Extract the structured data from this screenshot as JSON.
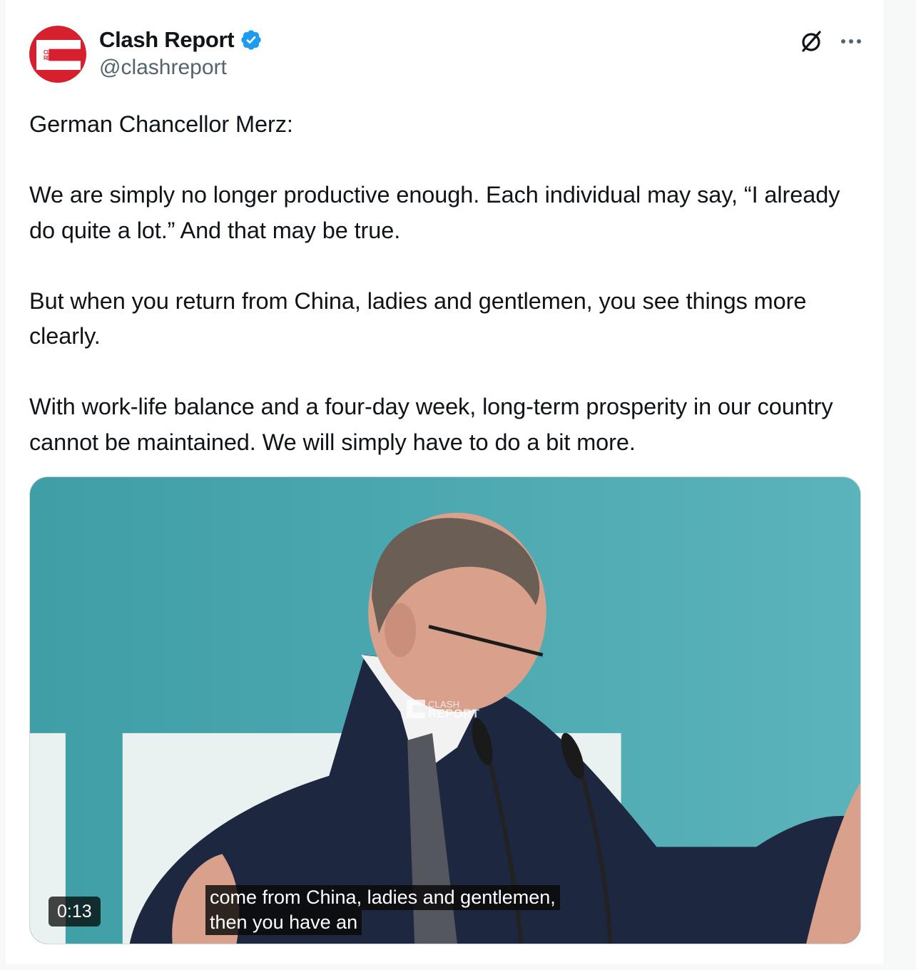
{
  "author": {
    "display_name": "Clash Report",
    "handle": "@clashreport",
    "avatar_text_line1": "CLASH",
    "avatar_text_line2": "REPORT",
    "verified": true,
    "avatar_color": "#d6202e",
    "verified_color": "#1d9bf0"
  },
  "actions": {
    "grok_icon": "grok-icon",
    "more_icon": "more-icon"
  },
  "tweet": {
    "paragraphs": [
      "German Chancellor Merz:",
      "We are simply no longer productive enough. Each individual may say, “I already do quite a lot.” And that may be true.",
      "But when you return from China, ladies and gentlemen, you see things more clearly.",
      "With work-life balance and a four-day week, long-term prosperity in our country cannot be maintained. We will simply have to do a bit more."
    ]
  },
  "media": {
    "duration": "0:13",
    "watermark_line1": "CLASH",
    "watermark_line2": "REPORT",
    "caption_line1": "come from China, ladies and gentlemen,",
    "caption_line2": "then you have an",
    "background_color": "#4aa4ad"
  }
}
